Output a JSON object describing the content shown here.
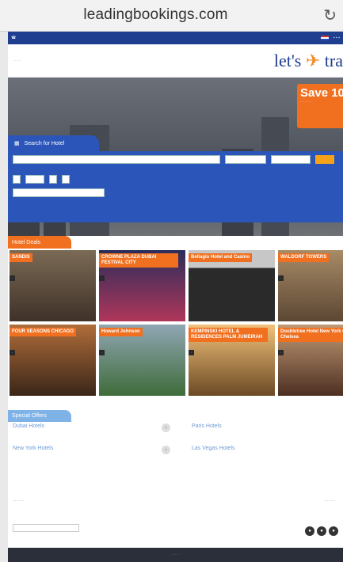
{
  "browser": {
    "url": "leadingbookings.com",
    "reload_icon": "reload-icon"
  },
  "site": {
    "search_tab": "Search for Hotel",
    "deals_title": "Hotel Deals",
    "special_title": "Special Offers",
    "promo": {
      "big": "Save 10"
    },
    "hotels": [
      {
        "name": "SANDIS"
      },
      {
        "name": "CROWNE PLAZA DUBAI FESTIVAL CITY"
      },
      {
        "name": "Bellagio Hotel and Casino"
      },
      {
        "name": "WALDORF TOWERS"
      },
      {
        "name": "FOUR SEASONS CHICAGO"
      },
      {
        "name": "Howard Johnson"
      },
      {
        "name": "KEMPINSKI HOTEL & RESIDENCES PALM JUMEIRAH"
      },
      {
        "name": "Doubletree Hotel New York City - Chelsea"
      }
    ],
    "offers": [
      {
        "label": "Dubai Hotels"
      },
      {
        "label": "Paris Hotels"
      },
      {
        "label": "New York Hotels"
      },
      {
        "label": "Las Vegas Hotels"
      }
    ]
  }
}
